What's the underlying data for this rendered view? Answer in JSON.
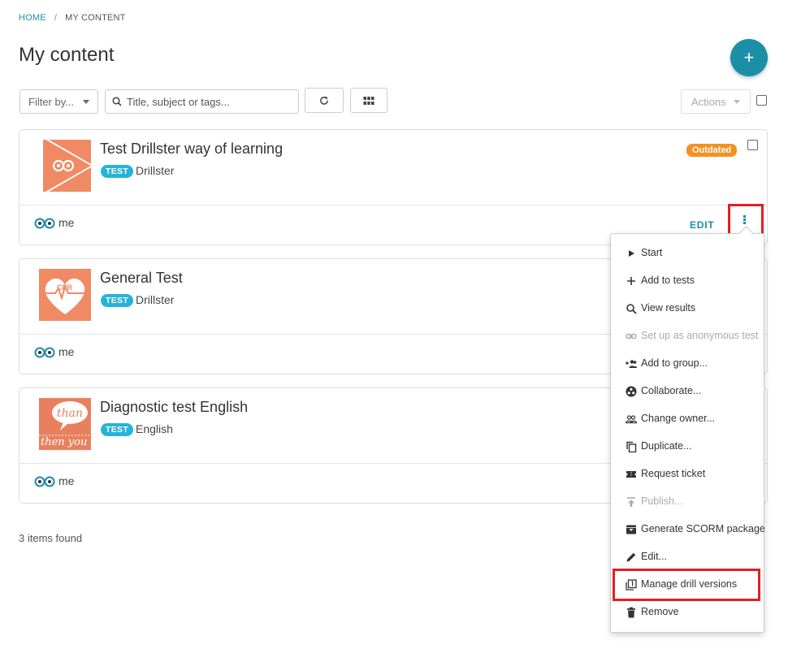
{
  "breadcrumb": {
    "home": "HOME",
    "separator": "/",
    "current": "MY CONTENT"
  },
  "page_title": "My content",
  "toolbar": {
    "filter_label": "Filter by...",
    "search_placeholder": "Title, subject or tags...",
    "actions_label": "Actions"
  },
  "items": [
    {
      "title": "Test Drillster way of learning",
      "tag": "TEST",
      "category": "Drillster",
      "owner": "me",
      "badge": "Outdated",
      "edit_label": "EDIT"
    },
    {
      "title": "General Test",
      "tag": "TEST",
      "category": "Drillster",
      "owner": "me"
    },
    {
      "title": "Diagnostic test English",
      "tag": "TEST",
      "category": "English",
      "owner": "me"
    }
  ],
  "thumb_text": {
    "cpr": "CPR",
    "than": "than",
    "then": "then you"
  },
  "items_found": "3 items found",
  "menu": [
    {
      "label": "Start",
      "icon": "play-icon",
      "disabled": false
    },
    {
      "label": "Add to tests",
      "icon": "plus-icon",
      "disabled": false
    },
    {
      "label": "View results",
      "icon": "search-icon",
      "disabled": false
    },
    {
      "label": "Set up as anonymous test",
      "icon": "link-icon",
      "disabled": true
    },
    {
      "label": "Add to group...",
      "icon": "group-add-icon",
      "disabled": false
    },
    {
      "label": "Collaborate...",
      "icon": "collaborate-icon",
      "disabled": false
    },
    {
      "label": "Change owner...",
      "icon": "people-icon",
      "disabled": false
    },
    {
      "label": "Duplicate...",
      "icon": "copy-icon",
      "disabled": false
    },
    {
      "label": "Request ticket",
      "icon": "ticket-icon",
      "disabled": false
    },
    {
      "label": "Publish...",
      "icon": "publish-icon",
      "disabled": true
    },
    {
      "label": "Generate SCORM package",
      "icon": "archive-icon",
      "disabled": false
    },
    {
      "label": "Edit...",
      "icon": "pencil-icon",
      "disabled": false
    },
    {
      "label": "Manage drill versions",
      "icon": "versions-icon",
      "disabled": false
    },
    {
      "label": "Remove",
      "icon": "trash-icon",
      "disabled": false
    }
  ],
  "colors": {
    "accent": "#1b8fa6",
    "tag": "#27b3d9",
    "outdated": "#f39222",
    "thumb": "#f08a65",
    "highlight": "#e31e24"
  }
}
